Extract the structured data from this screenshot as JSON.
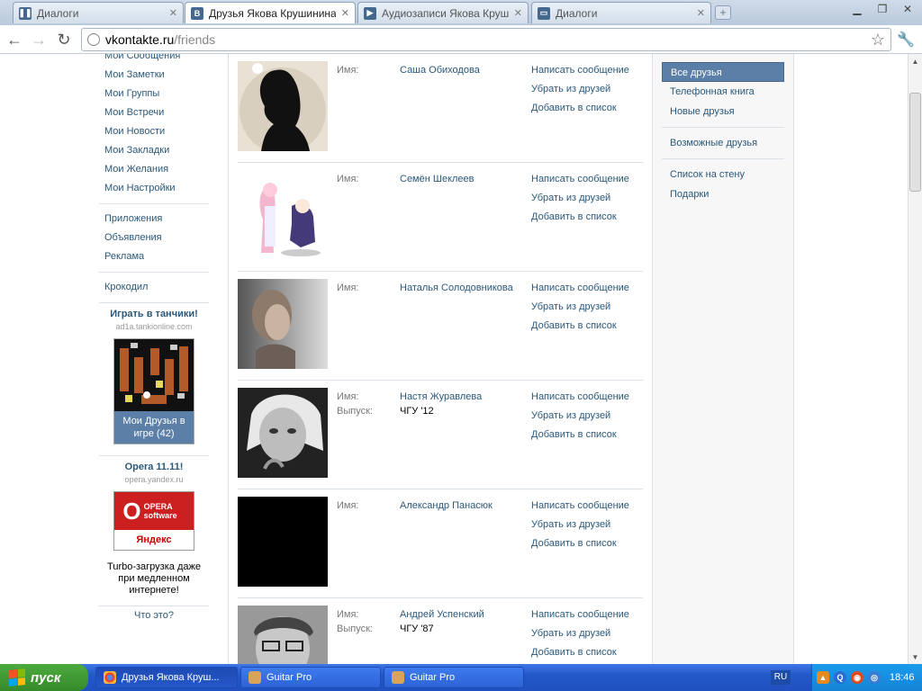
{
  "browser": {
    "tabs": [
      {
        "title": "Диалоги",
        "icon": "vk-dialog-icon",
        "active": false
      },
      {
        "title": "Друзья Якова Крушинина | В",
        "icon": "vk-icon",
        "active": true
      },
      {
        "title": "Аудиозаписи Якова Крушин",
        "icon": "vk-audio-icon",
        "active": false
      },
      {
        "title": "Диалоги",
        "icon": "vk-dialog-icon",
        "active": false
      }
    ],
    "url_host": "vkontakte.ru",
    "url_path": "/friends"
  },
  "left_menu": {
    "top_items": [
      "Мои Сообщения",
      "Мои Заметки",
      "Мои Группы",
      "Мои Встречи",
      "Мои Новости",
      "Мои Закладки",
      "Мои Желания",
      "Мои Настройки"
    ],
    "apps_items": [
      "Приложения",
      "Объявления",
      "Реклама"
    ],
    "extra_items": [
      "Крокодил"
    ]
  },
  "ads": [
    {
      "title": "Играть в танчики!",
      "domain": "ad1a.tankionline.com",
      "banner_text": "Мои Друзья в игре (42)"
    },
    {
      "title": "Opera 11.11!",
      "domain": "opera.yandex.ru",
      "banner_top": "OPERA software",
      "banner_bottom": "Яндекс",
      "body": "Turbo-загрузка даже при медленном интернете!"
    }
  ],
  "ad_help": "Что это?",
  "friends": {
    "labels": {
      "name": "Имя:",
      "graduation": "Выпуск:"
    },
    "actions": [
      "Написать сообщение",
      "Убрать из друзей",
      "Добавить в список"
    ],
    "list": [
      {
        "name": "Саша Обиходова",
        "graduation": ""
      },
      {
        "name": "Семён Шеклеев",
        "graduation": ""
      },
      {
        "name": "Наталья Солодовникова",
        "graduation": ""
      },
      {
        "name": "Настя Журавлева",
        "graduation": "ЧГУ '12"
      },
      {
        "name": "Александр Панасюк",
        "graduation": ""
      },
      {
        "name": "Андрей Успенский",
        "graduation": "ЧГУ '87"
      }
    ]
  },
  "right_menu": {
    "group1": [
      "Все друзья",
      "Телефонная книга",
      "Новые друзья"
    ],
    "group2": [
      "Возможные друзья"
    ],
    "group3": [
      "Список на стену",
      "Подарки"
    ]
  },
  "taskbar": {
    "start_label": "пуск",
    "tasks": [
      "Друзья Якова Круш...",
      "Guitar Pro",
      "Guitar Pro"
    ],
    "lang": "RU",
    "clock": "18:46"
  }
}
